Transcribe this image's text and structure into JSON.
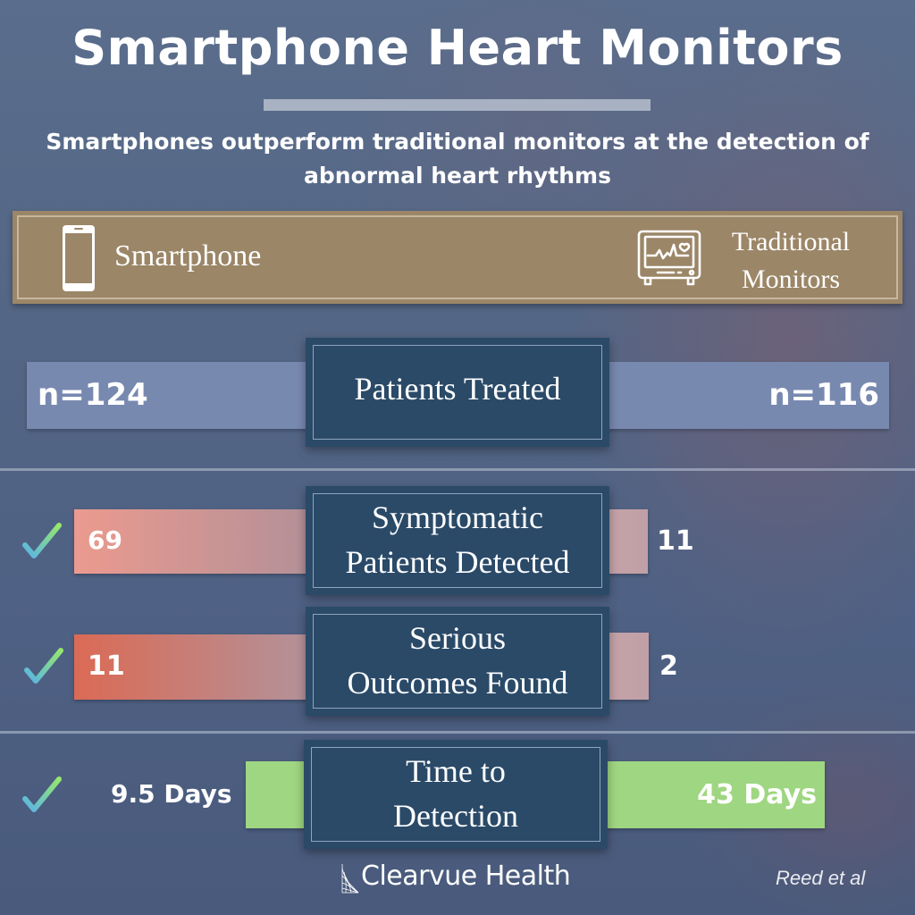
{
  "header": {
    "title": "Smartphone Heart Monitors",
    "subtitle": "Smartphones outperform traditional monitors at the detection of abnormal heart rhythms"
  },
  "legend": {
    "left": {
      "label": "Smartphone",
      "icon": "smartphone-icon"
    },
    "right": {
      "label_line1": "Traditional",
      "label_line2": "Monitors",
      "icon": "heart-monitor-icon"
    }
  },
  "rows": [
    {
      "label_line1": "Patients Treated",
      "smartphone_value": "n=124",
      "traditional_value": "n=116",
      "smartphone_wins": false,
      "bar_color": "#7889b0"
    },
    {
      "label_line1": "Symptomatic",
      "label_line2": "Patients Detected",
      "smartphone_value": "69",
      "traditional_value": "11",
      "smartphone_wins": true,
      "bar_color_start": "#eb9a8e",
      "bar_color_end": "#b29098"
    },
    {
      "label_line1": "Serious",
      "label_line2": "Outcomes Found",
      "smartphone_value": "11",
      "traditional_value": "2",
      "smartphone_wins": true,
      "bar_color_start": "#db6a55",
      "bar_color_end": "#b2939b"
    },
    {
      "label_line1": "Time to",
      "label_line2": "Detection",
      "smartphone_value": "9.5 Days",
      "traditional_value": "43 Days",
      "smartphone_wins": true,
      "bar_color": "#9fd681"
    }
  ],
  "footer": {
    "brand": "Clearvue Health",
    "citation": "Reed et al"
  },
  "colors": {
    "legend_bg": "#9b8667",
    "center_box": "#2a4a68",
    "check_start": "#5ab4e6",
    "check_end": "#95e86c"
  }
}
